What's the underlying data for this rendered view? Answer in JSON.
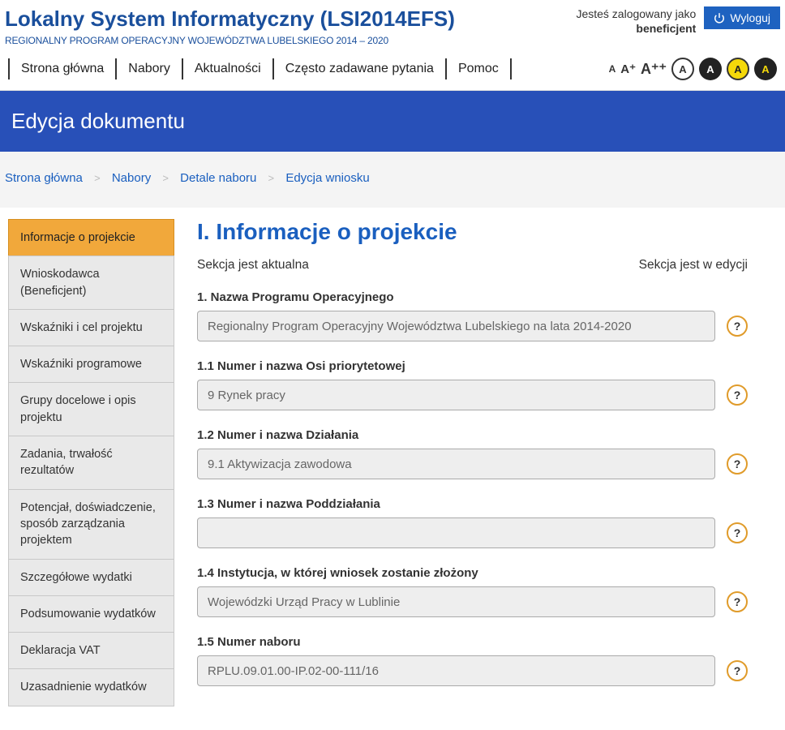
{
  "header": {
    "title": "Lokalny System Informatyczny (LSI2014EFS)",
    "subtitle": "REGIONALNY PROGRAM OPERACYJNY WOJEWÓDZTWA LUBELSKIEGO 2014 – 2020",
    "logged_in_label": "Jesteś zalogowany jako",
    "user": "beneficjent",
    "logout": "Wyloguj"
  },
  "nav": {
    "items": [
      "Strona główna",
      "Nabory",
      "Aktualności",
      "Często zadawane pytania",
      "Pomoc"
    ]
  },
  "accessibility": {
    "a_small": "A",
    "a_plus": "A⁺",
    "a_plusplus": "A⁺⁺",
    "circle_label": "A"
  },
  "banner": {
    "title": "Edycja dokumentu"
  },
  "breadcrumb": {
    "items": [
      "Strona główna",
      "Nabory",
      "Detale naboru",
      "Edycja wniosku"
    ],
    "sep": ">"
  },
  "sidebar": {
    "items": [
      "Informacje o projekcie",
      "Wnioskodawca (Beneficjent)",
      "Wskaźniki i cel projektu",
      "Wskaźniki programowe",
      "Grupy docelowe i opis projektu",
      "Zadania, trwałość rezultatów",
      "Potencjał, doświadczenie, sposób zarządzania projektem",
      "Szczegółowe wydatki",
      "Podsumowanie wydatków",
      "Deklaracja VAT",
      "Uzasadnienie wydatków"
    ]
  },
  "main": {
    "title": "I. Informacje o projekcie",
    "status_left": "Sekcja jest aktualna",
    "status_right": "Sekcja jest w edycji",
    "fields": [
      {
        "label": "1. Nazwa Programu Operacyjnego",
        "value": "Regionalny Program Operacyjny Województwa Lubelskiego na lata 2014-2020"
      },
      {
        "label": "1.1 Numer i nazwa Osi priorytetowej",
        "value": "9 Rynek pracy"
      },
      {
        "label": "1.2 Numer i nazwa Działania",
        "value": "9.1 Aktywizacja zawodowa"
      },
      {
        "label": "1.3 Numer i nazwa Poddziałania",
        "value": ""
      },
      {
        "label": "1.4 Instytucja, w której wniosek zostanie złożony",
        "value": "Wojewódzki Urząd Pracy w Lublinie"
      },
      {
        "label": "1.5 Numer naboru",
        "value": "RPLU.09.01.00-IP.02-00-111/16"
      }
    ],
    "help": "?"
  }
}
